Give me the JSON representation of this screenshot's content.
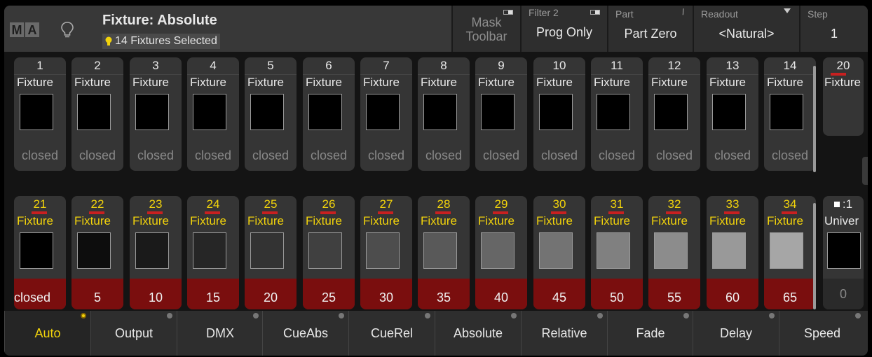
{
  "header": {
    "logo": [
      "M",
      "A"
    ],
    "title": "Fixture: Absolute",
    "selection_text": "14 Fixtures Selected",
    "mask_toolbar": [
      "Mask",
      "Toolbar"
    ],
    "filter": {
      "label": "Filter 2",
      "value": "Prog Only"
    },
    "part": {
      "label": "Part",
      "value": "Part Zero"
    },
    "readout": {
      "label": "Readout",
      "value": "<Natural>"
    },
    "step": {
      "label": "Step",
      "value": "1"
    }
  },
  "row1": [
    {
      "num": "1",
      "name": "Fixture",
      "value": "closed"
    },
    {
      "num": "2",
      "name": "Fixture",
      "value": "closed"
    },
    {
      "num": "3",
      "name": "Fixture",
      "value": "closed"
    },
    {
      "num": "4",
      "name": "Fixture",
      "value": "closed"
    },
    {
      "num": "5",
      "name": "Fixture",
      "value": "closed"
    },
    {
      "num": "6",
      "name": "Fixture",
      "value": "closed"
    },
    {
      "num": "7",
      "name": "Fixture",
      "value": "closed"
    },
    {
      "num": "8",
      "name": "Fixture",
      "value": "closed"
    },
    {
      "num": "9",
      "name": "Fixture",
      "value": "closed"
    },
    {
      "num": "10",
      "name": "Fixture",
      "value": "closed"
    },
    {
      "num": "11",
      "name": "Fixture",
      "value": "closed"
    },
    {
      "num": "12",
      "name": "Fixture",
      "value": "closed"
    },
    {
      "num": "13",
      "name": "Fixture",
      "value": "closed"
    },
    {
      "num": "14",
      "name": "Fixture",
      "value": "closed"
    }
  ],
  "row1_extra": {
    "num": "20",
    "name": "Fixture"
  },
  "row2": [
    {
      "num": "21",
      "name": "Fixture",
      "value": "closed",
      "swatch": "#000000"
    },
    {
      "num": "22",
      "name": "Fixture",
      "value": "5",
      "swatch": "#0d0d0d"
    },
    {
      "num": "23",
      "name": "Fixture",
      "value": "10",
      "swatch": "#1a1a1a"
    },
    {
      "num": "24",
      "name": "Fixture",
      "value": "15",
      "swatch": "#262626"
    },
    {
      "num": "25",
      "name": "Fixture",
      "value": "20",
      "swatch": "#333333"
    },
    {
      "num": "26",
      "name": "Fixture",
      "value": "25",
      "swatch": "#404040"
    },
    {
      "num": "27",
      "name": "Fixture",
      "value": "30",
      "swatch": "#4d4d4d"
    },
    {
      "num": "28",
      "name": "Fixture",
      "value": "35",
      "swatch": "#595959"
    },
    {
      "num": "29",
      "name": "Fixture",
      "value": "40",
      "swatch": "#666666"
    },
    {
      "num": "30",
      "name": "Fixture",
      "value": "45",
      "swatch": "#737373"
    },
    {
      "num": "31",
      "name": "Fixture",
      "value": "50",
      "swatch": "#808080"
    },
    {
      "num": "32",
      "name": "Fixture",
      "value": "55",
      "swatch": "#8c8c8c"
    },
    {
      "num": "33",
      "name": "Fixture",
      "value": "60",
      "swatch": "#999999"
    },
    {
      "num": "34",
      "name": "Fixture",
      "value": "65",
      "swatch": "#a6a6a6"
    }
  ],
  "row2_extra": {
    "num": ":1",
    "name": "Univer",
    "value": "0"
  },
  "tabs": [
    "Auto",
    "Output",
    "DMX",
    "CueAbs",
    "CueRel",
    "Absolute",
    "Relative",
    "Fade",
    "Delay",
    "Speed"
  ],
  "colors": {
    "selected": "#f2d30b",
    "active_value_bg": "#7a0e0e",
    "selection_bar": "#c82020"
  }
}
